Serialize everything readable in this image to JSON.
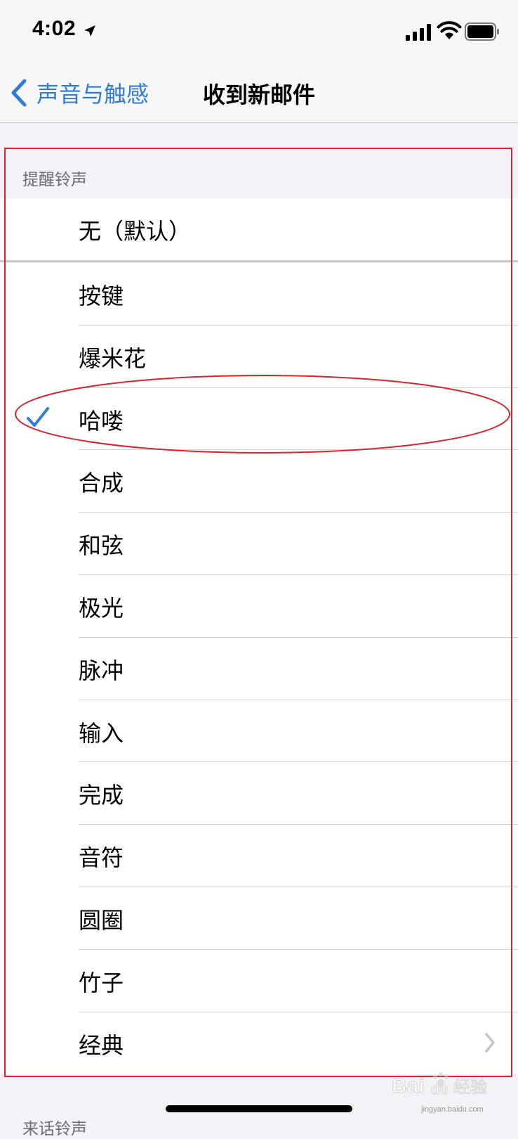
{
  "status_bar": {
    "time": "4:02"
  },
  "nav": {
    "back_label": "声音与触感",
    "title": "收到新邮件"
  },
  "section": {
    "header": "提醒铃声"
  },
  "default_option": {
    "label": "无（默认）"
  },
  "tones": [
    {
      "label": "按键",
      "selected": false
    },
    {
      "label": "爆米花",
      "selected": false
    },
    {
      "label": "哈喽",
      "selected": true
    },
    {
      "label": "合成",
      "selected": false
    },
    {
      "label": "和弦",
      "selected": false
    },
    {
      "label": "极光",
      "selected": false
    },
    {
      "label": "脉冲",
      "selected": false
    },
    {
      "label": "输入",
      "selected": false
    },
    {
      "label": "完成",
      "selected": false
    },
    {
      "label": "音符",
      "selected": false
    },
    {
      "label": "圆圈",
      "selected": false
    },
    {
      "label": "竹子",
      "selected": false
    },
    {
      "label": "经典",
      "selected": false,
      "disclosure": true
    }
  ],
  "next_section": {
    "header": "来话铃声"
  },
  "colors": {
    "accent": "#2f7ddb",
    "annotation": "#d9232d",
    "background": "#f2f2f7"
  },
  "watermark": {
    "text": "jingyan.baidu.com"
  }
}
